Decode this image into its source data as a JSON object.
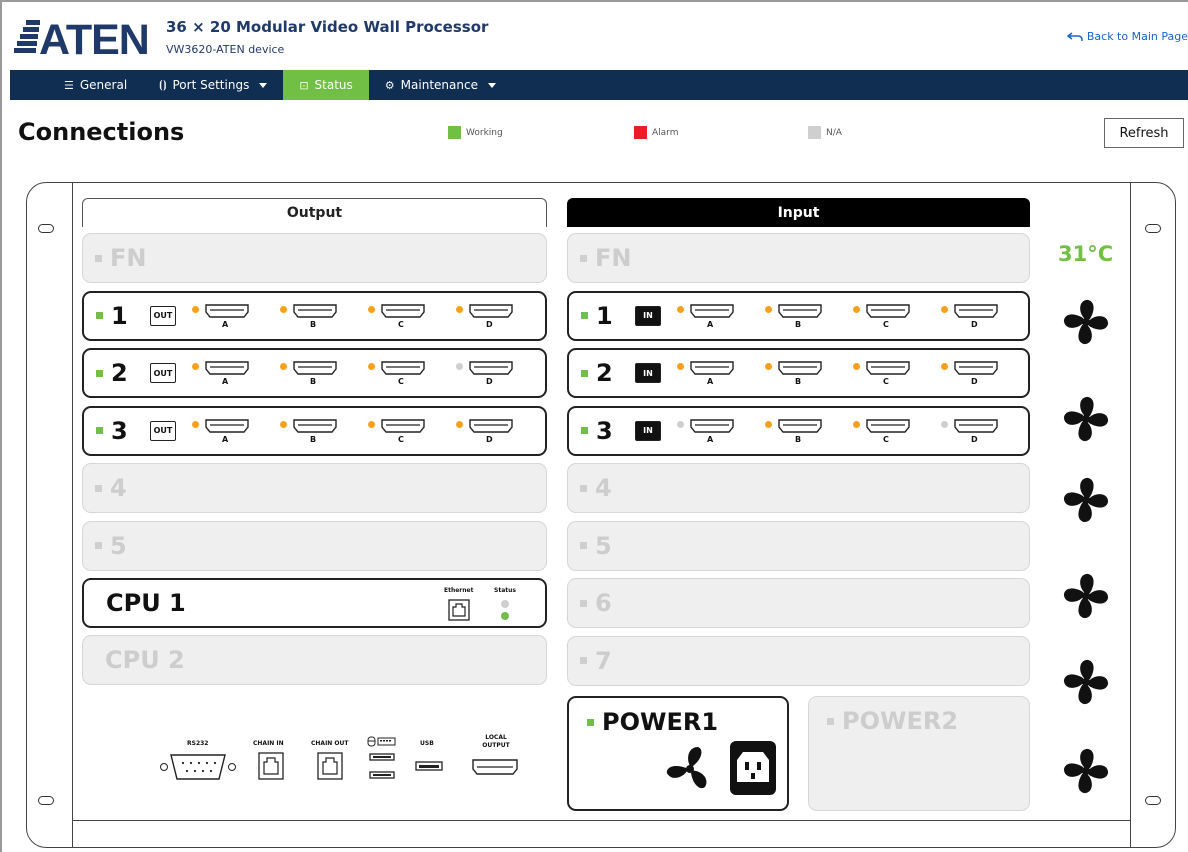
{
  "header": {
    "brand": "ATEN",
    "title": "36 × 20 Modular Video Wall Processor",
    "subtitle": "VW3620-ATEN device",
    "back_link": "Back to Main Page"
  },
  "nav": {
    "items": [
      {
        "label": "General",
        "icon": "list-icon",
        "active": false,
        "dropdown": false
      },
      {
        "label": "Port Settings",
        "icon": "port-icon",
        "active": false,
        "dropdown": true
      },
      {
        "label": "Status",
        "icon": "status-icon",
        "active": true,
        "dropdown": false
      },
      {
        "label": "Maintenance",
        "icon": "gear-icon",
        "active": false,
        "dropdown": true
      }
    ]
  },
  "page": {
    "title": "Connections",
    "refresh_label": "Refresh"
  },
  "legend": [
    {
      "label": "Working",
      "color": "#71bf45"
    },
    {
      "label": "Alarm",
      "color": "#ee1c25"
    },
    {
      "label": "N/A",
      "color": "#cfcfcf"
    }
  ],
  "status_colors": {
    "working": "#71bf45",
    "alarm": "#ee1c25",
    "na": "#cfcfcf",
    "signal": "#f7a01d"
  },
  "output": {
    "header": "Output",
    "fn_label": "FN",
    "slots": [
      {
        "label": "1",
        "installed": true,
        "badge": "OUT",
        "ports": [
          {
            "name": "A",
            "state": "signal"
          },
          {
            "name": "B",
            "state": "signal"
          },
          {
            "name": "C",
            "state": "signal"
          },
          {
            "name": "D",
            "state": "signal"
          }
        ]
      },
      {
        "label": "2",
        "installed": true,
        "badge": "OUT",
        "ports": [
          {
            "name": "A",
            "state": "signal"
          },
          {
            "name": "B",
            "state": "signal"
          },
          {
            "name": "C",
            "state": "signal"
          },
          {
            "name": "D",
            "state": "na"
          }
        ]
      },
      {
        "label": "3",
        "installed": true,
        "badge": "OUT",
        "ports": [
          {
            "name": "A",
            "state": "signal"
          },
          {
            "name": "B",
            "state": "signal"
          },
          {
            "name": "C",
            "state": "signal"
          },
          {
            "name": "D",
            "state": "signal"
          }
        ]
      },
      {
        "label": "4",
        "installed": false
      },
      {
        "label": "5",
        "installed": false
      }
    ]
  },
  "input": {
    "header": "Input",
    "fn_label": "FN",
    "slots": [
      {
        "label": "1",
        "installed": true,
        "badge": "IN",
        "ports": [
          {
            "name": "A",
            "state": "signal"
          },
          {
            "name": "B",
            "state": "signal"
          },
          {
            "name": "C",
            "state": "signal"
          },
          {
            "name": "D",
            "state": "signal"
          }
        ]
      },
      {
        "label": "2",
        "installed": true,
        "badge": "IN",
        "ports": [
          {
            "name": "A",
            "state": "signal"
          },
          {
            "name": "B",
            "state": "signal"
          },
          {
            "name": "C",
            "state": "signal"
          },
          {
            "name": "D",
            "state": "signal"
          }
        ]
      },
      {
        "label": "3",
        "installed": true,
        "badge": "IN",
        "ports": [
          {
            "name": "A",
            "state": "na"
          },
          {
            "name": "B",
            "state": "signal"
          },
          {
            "name": "C",
            "state": "signal"
          },
          {
            "name": "D",
            "state": "na"
          }
        ]
      },
      {
        "label": "4",
        "installed": false
      },
      {
        "label": "5",
        "installed": false
      },
      {
        "label": "6",
        "installed": false
      },
      {
        "label": "7",
        "installed": false
      }
    ]
  },
  "cpu": [
    {
      "label": "CPU 1",
      "installed": true,
      "ethernet_label": "Ethernet",
      "status_label": "Status"
    },
    {
      "label": "CPU 2",
      "installed": false
    }
  ],
  "io_panel": {
    "rs232": "RS232",
    "chain_in": "CHAIN IN",
    "chain_out": "CHAIN OUT",
    "usb": "USB",
    "local_output": "LOCAL OUTPUT"
  },
  "temperature": "31°C",
  "power": [
    {
      "label": "POWER1",
      "installed": true
    },
    {
      "label": "POWER2",
      "installed": false
    }
  ],
  "fans": {
    "count": 6,
    "icon": "fan-icon"
  }
}
